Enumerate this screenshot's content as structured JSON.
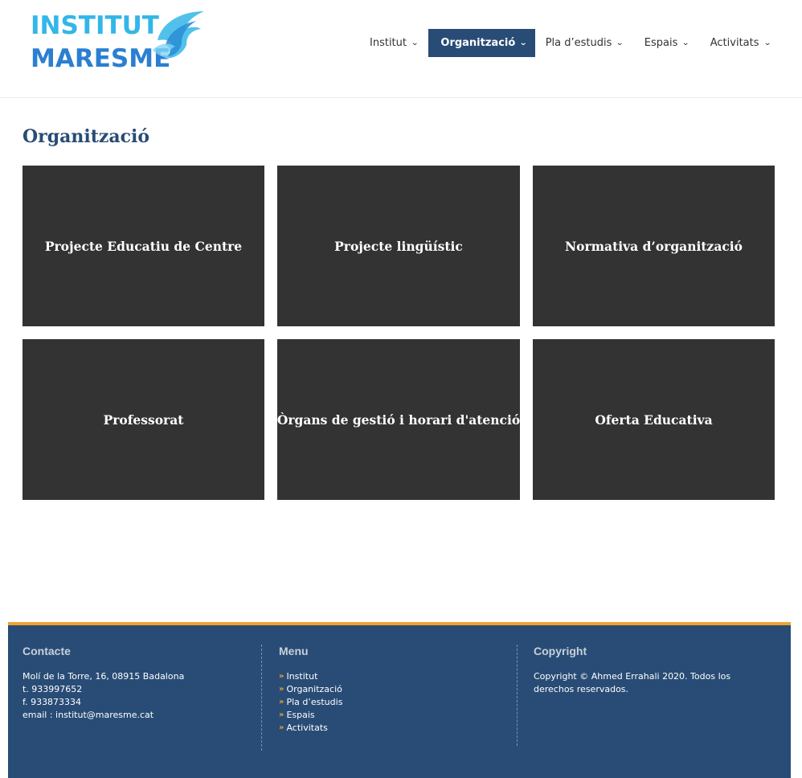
{
  "logo": {
    "line1": "INSTITUT",
    "line2": "MARESME"
  },
  "nav": [
    {
      "label": "Institut"
    },
    {
      "label": "Organització",
      "active": true
    },
    {
      "label": "Pla d’estudis"
    },
    {
      "label": "Espais"
    },
    {
      "label": "Activitats"
    }
  ],
  "page": {
    "title": "Organització"
  },
  "tiles": [
    "Projecte Educatiu de Centre",
    "Projecte lingüístic",
    "Normativa d’organització",
    "Professorat",
    "Òrgans de gestió i horari d'atenció",
    "Oferta Educativa"
  ],
  "footer": {
    "contact": {
      "heading": "Contacte",
      "address": "Molí de la Torre, 16, 08915 Badalona",
      "phone": "t. 933997652",
      "fax": "f. 933873334",
      "email": "email : institut@maresme.cat"
    },
    "menu": {
      "heading": "Menu",
      "items": [
        "Institut",
        "Organització",
        "Pla d’estudis",
        "Espais",
        "Activitats"
      ]
    },
    "copyright": {
      "heading": "Copyright",
      "text": "Copyright © Ahmed Errahali 2020. Todos los derechos reservados."
    }
  },
  "colors": {
    "primary": "#284c75",
    "accent": "#f0a130",
    "tile": "#333333",
    "logo_light": "#33b6e8",
    "logo_dark": "#2b7fd1"
  }
}
